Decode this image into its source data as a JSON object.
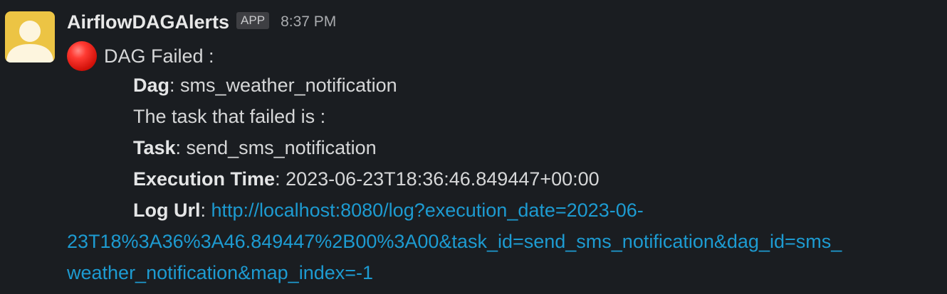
{
  "message": {
    "sender": "AirflowDAGAlerts",
    "badge": "APP",
    "timestamp": "8:37 PM",
    "avatar_icon": "default-user-avatar",
    "status_icon": "red-circle-emoji",
    "status_text": "DAG Failed :",
    "dag_label": "Dag",
    "dag_value": ": sms_weather_notification",
    "failed_text": "The task that failed is :",
    "task_label": "Task",
    "task_value": ": send_sms_notification",
    "exec_label": "Execution Time",
    "exec_value": ": 2023-06-23T18:36:46.849447+00:00",
    "log_label": "Log Url",
    "log_sep": ": ",
    "log_url_line1": "http://localhost:8080/log?execution_date=2023-06-",
    "log_url_line2": "23T18%3A36%3A46.849447%2B00%3A00&task_id=send_sms_notification&dag_id=sms_",
    "log_url_line3": "weather_notification&map_index=-1"
  },
  "colors": {
    "background": "#1a1d21",
    "avatar_bg": "#ecc444",
    "link": "#1d9bd1",
    "error_red": "#e01e13"
  }
}
